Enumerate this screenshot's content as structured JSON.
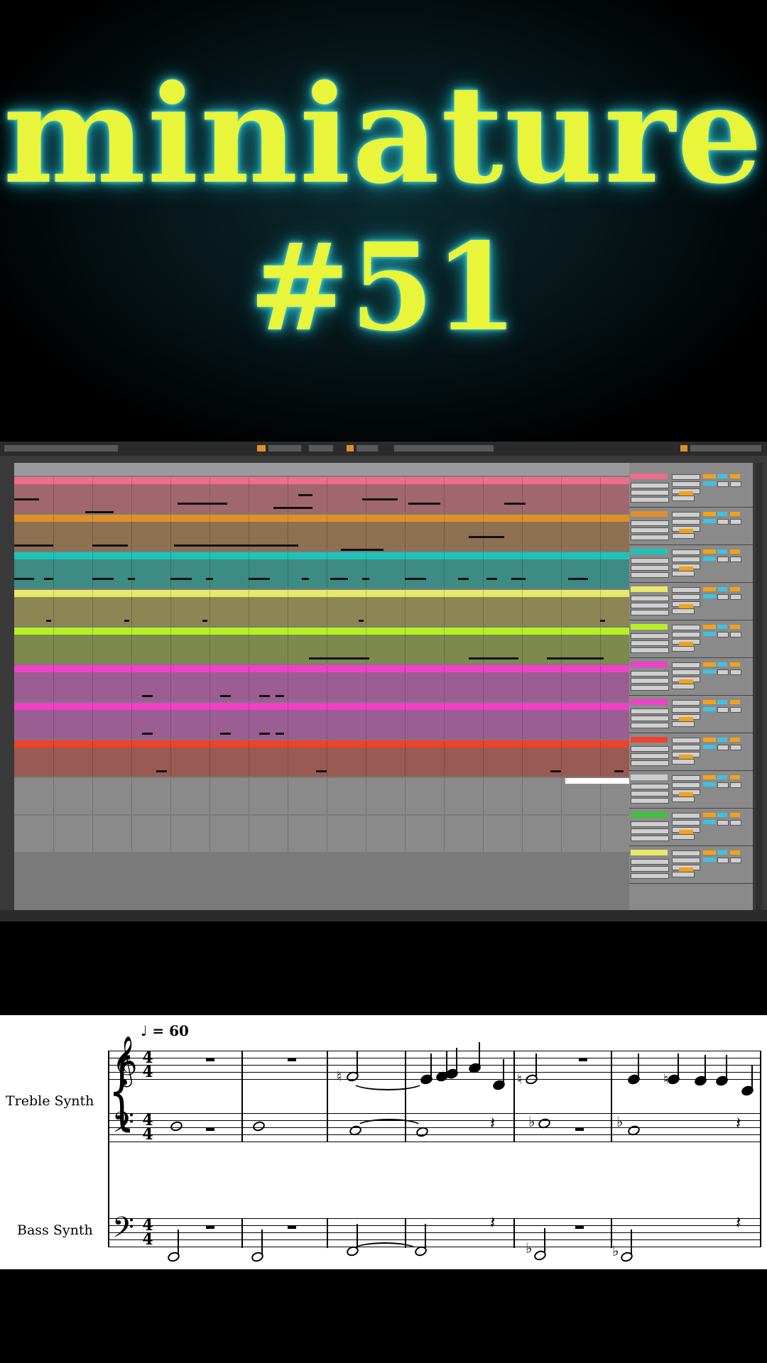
{
  "title": {
    "word": "miniature",
    "number": "#51"
  },
  "colors": {
    "title_text": "#e8f53a",
    "title_glow": "#2bb9c6",
    "tracks": [
      "#f06c8c",
      "#e0902a",
      "#20c2b8",
      "#e8e86a",
      "#b6f024",
      "#f040c8",
      "#f040c8",
      "#f04030",
      "#b8b8b8",
      "#b8b8b8"
    ],
    "lane_bodies": [
      "#a0686e",
      "#8e7052",
      "#3e8a84",
      "#8c8654",
      "#7c8a4e",
      "#9c5e92",
      "#9c5e92",
      "#9a5a54",
      "#8a8a8a",
      "#8a8a8a"
    ]
  },
  "daw": {
    "window": "Ableton Live arrangement view",
    "mixer_tag_colors": [
      "#f06c8c",
      "#e0902a",
      "#20c2b8",
      "#e8e86a",
      "#b6f024",
      "#f040c8",
      "#f040c8",
      "#f04030",
      "#cccccc",
      "#40c040"
    ]
  },
  "score": {
    "tempo": "♩ = 60",
    "staves": [
      {
        "name": "Treble Synth"
      },
      {
        "name": "Bass Synth"
      }
    ],
    "time_signature": {
      "top": "4",
      "bottom": "4"
    },
    "clefs": {
      "treble": "𝄞",
      "bass": "𝄢"
    },
    "accidentals": {
      "natural": "♮",
      "flat": "♭"
    }
  }
}
